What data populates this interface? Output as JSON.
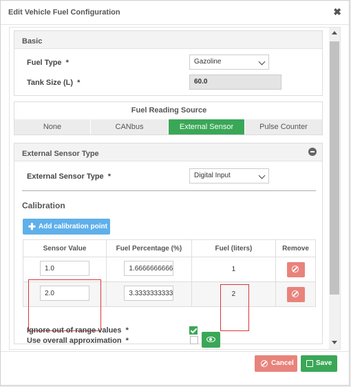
{
  "dialog": {
    "title": "Edit Vehicle Fuel Configuration",
    "close_icon": "close-icon"
  },
  "basic": {
    "header": "Basic",
    "fuel_type_label": "Fuel Type",
    "fuel_type_value": "Gazoline",
    "tank_size_label": "Tank Size (L)",
    "tank_size_value": "60.0",
    "required_mark": "*"
  },
  "fuel_source": {
    "header": "Fuel Reading Source",
    "tabs": [
      "None",
      "CANbus",
      "External Sensor",
      "Pulse Counter"
    ],
    "active_tab": "External Sensor"
  },
  "external_sensor": {
    "header": "External Sensor Type",
    "type_label": "External Sensor Type",
    "type_value": "Digital Input"
  },
  "calibration": {
    "title": "Calibration",
    "add_button": "Add calibration point",
    "columns": [
      "Sensor Value",
      "Fuel Percentage (%)",
      "Fuel (liters)",
      "Remove"
    ],
    "rows": [
      {
        "sensor_value": "1.0",
        "fuel_percentage": "1.6666666666667",
        "fuel_liters": "1"
      },
      {
        "sensor_value": "2.0",
        "fuel_percentage": "3.3333333333333",
        "fuel_liters": "2"
      }
    ],
    "use_approx_label": "Use overall approximation",
    "use_approx_checked": false,
    "ignore_range_label": "Ignore out of range values",
    "ignore_range_checked": true
  },
  "footer": {
    "cancel_label": "Cancel",
    "save_label": "Save"
  },
  "colors": {
    "green": "#3aa757",
    "red": "#e8837b",
    "blue": "#5fb0ea",
    "highlight": "#d9343a"
  }
}
